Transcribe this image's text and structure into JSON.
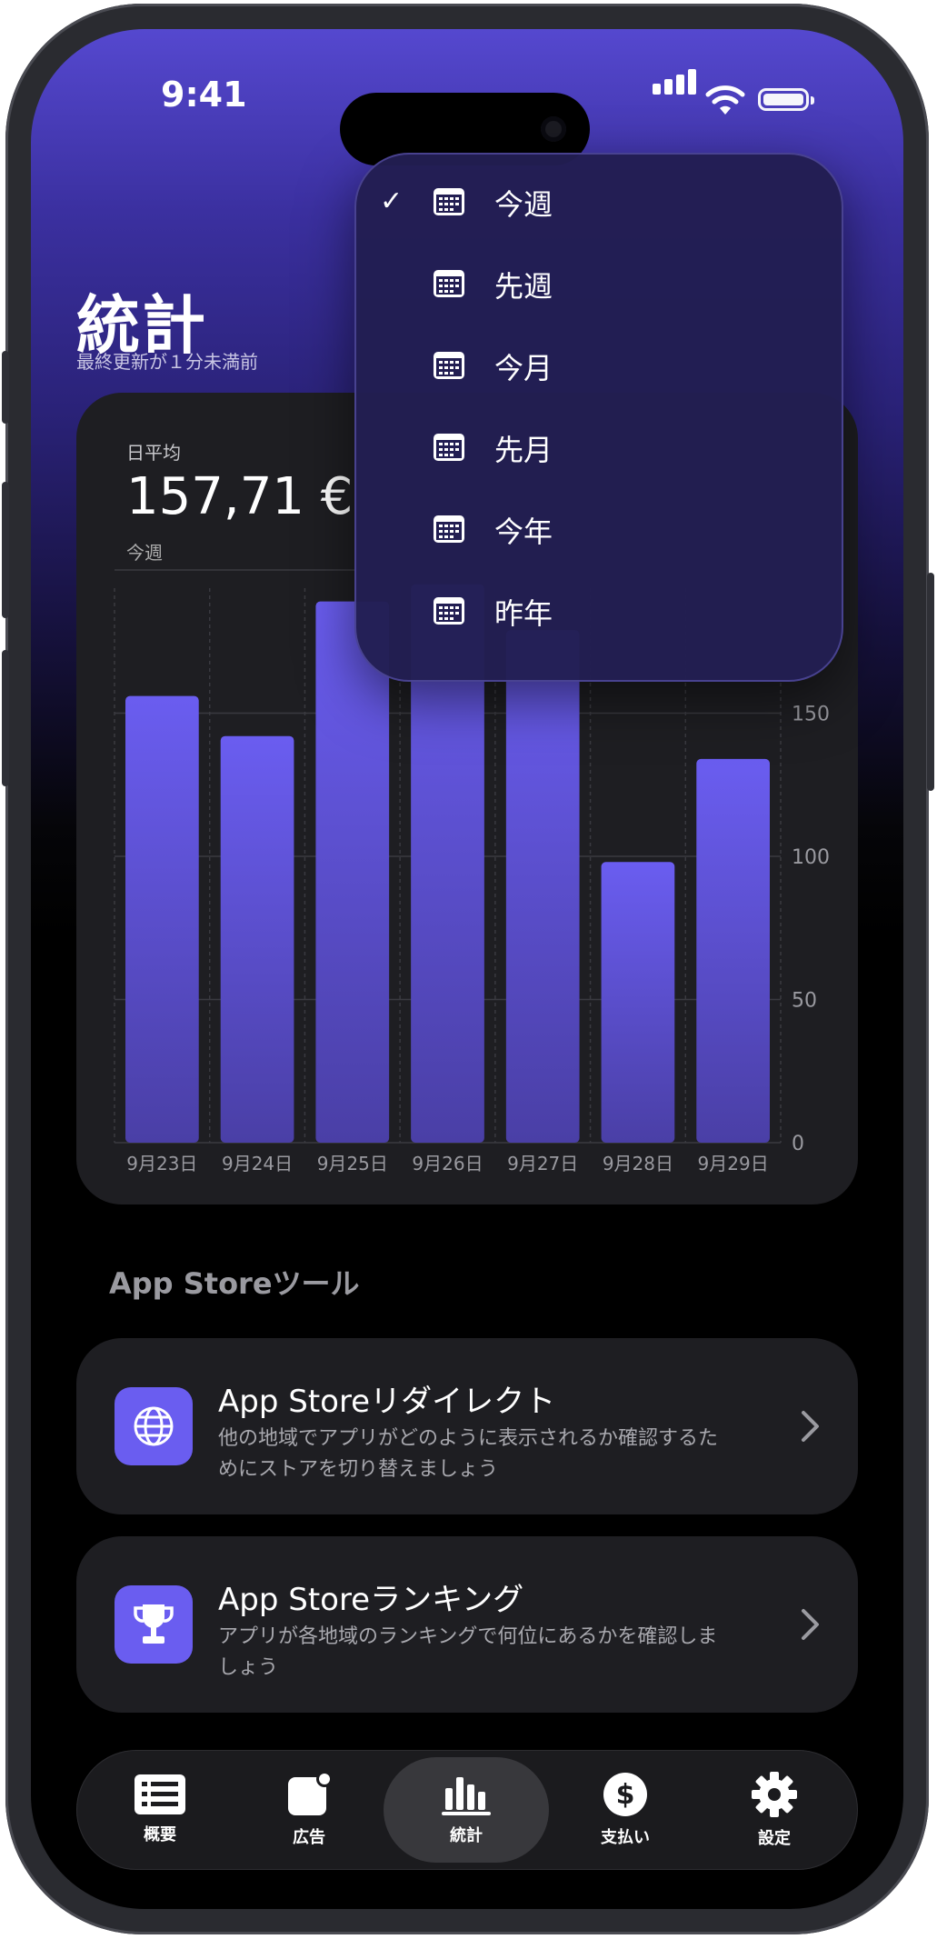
{
  "status": {
    "time": "9:41"
  },
  "header": {
    "title": "統計",
    "subtitle": "最終更新が１分未満前"
  },
  "summary": {
    "label": "日平均",
    "value": "157,71 €",
    "period": "今週"
  },
  "chart_data": {
    "type": "bar",
    "categories": [
      "9月23日",
      "9月24日",
      "9月25日",
      "9月26日",
      "9月27日",
      "9月28日",
      "9月29日"
    ],
    "values": [
      156,
      142,
      189,
      195,
      179,
      98,
      134
    ],
    "yticks": [
      0,
      50,
      100,
      150
    ],
    "ylim": [
      0,
      200
    ],
    "grid": true,
    "bar_color": "#6a5df0"
  },
  "menu": {
    "items": [
      {
        "label": "今週",
        "checked": true
      },
      {
        "label": "先週",
        "checked": false
      },
      {
        "label": "今月",
        "checked": false
      },
      {
        "label": "先月",
        "checked": false
      },
      {
        "label": "今年",
        "checked": false
      },
      {
        "label": "昨年",
        "checked": false
      }
    ],
    "check_glyph": "✓",
    "icon": "calendar-icon"
  },
  "tools": {
    "section_title": "App Storeツール",
    "items": [
      {
        "title": "App Storeリダイレクト",
        "description": "他の地域でアプリがどのように表示されるか確認するためにストアを切り替えましょう",
        "icon": "globe-icon"
      },
      {
        "title": "App Storeランキング",
        "description": "アプリが各地域のランキングで何位にあるかを確認しましょう",
        "icon": "trophy-icon"
      }
    ]
  },
  "tabbar": {
    "items": [
      {
        "label": "概要",
        "icon": "list-icon"
      },
      {
        "label": "広告",
        "icon": "ads-icon"
      },
      {
        "label": "統計",
        "icon": "chart-icon",
        "active": true
      },
      {
        "label": "支払い",
        "icon": "dollar-icon"
      },
      {
        "label": "設定",
        "icon": "gear-icon"
      }
    ]
  },
  "colors": {
    "accent": "#6a5df0",
    "header_top": "#5548cf",
    "card": "#1e1e22"
  }
}
